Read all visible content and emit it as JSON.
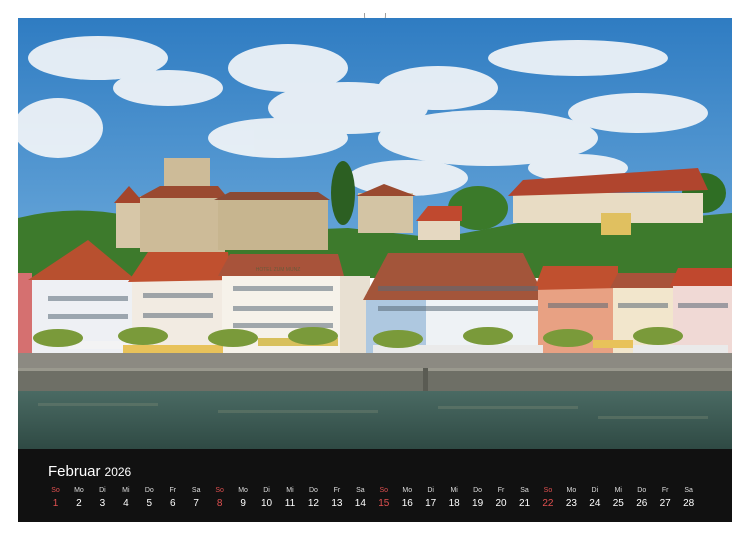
{
  "calendar": {
    "month": "Februar",
    "year": "2026",
    "days": [
      {
        "wd": "So",
        "d": "1",
        "sunday": true
      },
      {
        "wd": "Mo",
        "d": "2",
        "sunday": false
      },
      {
        "wd": "Di",
        "d": "3",
        "sunday": false
      },
      {
        "wd": "Mi",
        "d": "4",
        "sunday": false
      },
      {
        "wd": "Do",
        "d": "5",
        "sunday": false
      },
      {
        "wd": "Fr",
        "d": "6",
        "sunday": false
      },
      {
        "wd": "Sa",
        "d": "7",
        "sunday": false
      },
      {
        "wd": "So",
        "d": "8",
        "sunday": true
      },
      {
        "wd": "Mo",
        "d": "9",
        "sunday": false
      },
      {
        "wd": "Di",
        "d": "10",
        "sunday": false
      },
      {
        "wd": "Mi",
        "d": "11",
        "sunday": false
      },
      {
        "wd": "Do",
        "d": "12",
        "sunday": false
      },
      {
        "wd": "Fr",
        "d": "13",
        "sunday": false
      },
      {
        "wd": "Sa",
        "d": "14",
        "sunday": false
      },
      {
        "wd": "So",
        "d": "15",
        "sunday": true
      },
      {
        "wd": "Mo",
        "d": "16",
        "sunday": false
      },
      {
        "wd": "Di",
        "d": "17",
        "sunday": false
      },
      {
        "wd": "Mi",
        "d": "18",
        "sunday": false
      },
      {
        "wd": "Do",
        "d": "19",
        "sunday": false
      },
      {
        "wd": "Fr",
        "d": "20",
        "sunday": false
      },
      {
        "wd": "Sa",
        "d": "21",
        "sunday": false
      },
      {
        "wd": "So",
        "d": "22",
        "sunday": true
      },
      {
        "wd": "Mo",
        "d": "23",
        "sunday": false
      },
      {
        "wd": "Di",
        "d": "24",
        "sunday": false
      },
      {
        "wd": "Mi",
        "d": "25",
        "sunday": false
      },
      {
        "wd": "Do",
        "d": "26",
        "sunday": false
      },
      {
        "wd": "Fr",
        "d": "27",
        "sunday": false
      },
      {
        "wd": "Sa",
        "d": "28",
        "sunday": false
      }
    ]
  },
  "photo": {
    "hotel_sign": "HOTEL ZUM MUNZ"
  },
  "colors": {
    "sunday": "#e05050",
    "calendar_bg": "#111111",
    "sky": "#3d86c6",
    "water": "#3f5a4f",
    "roof": "#b8502f"
  }
}
